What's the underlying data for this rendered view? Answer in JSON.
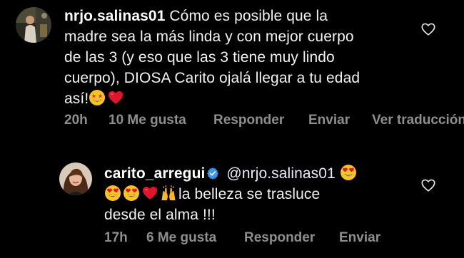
{
  "comments": [
    {
      "username": "nrjo.salinas01",
      "lines": [
        "Cómo es posible que la",
        "madre sea la más linda y con mejor cuerpo",
        "de las 3 (y eso que las 3 tiene muy lindo",
        "cuerpo), DIOSA Carito ojalá llegar a tu edad",
        "así!"
      ],
      "trailing_emojis": [
        "star-struck-emoji",
        "red-heart-emoji"
      ],
      "time": "20h",
      "likes": "10 Me gusta",
      "reply_label": "Responder",
      "send_label": "Enviar",
      "translate_label": "Ver traducción"
    },
    {
      "username": "carito_arregui",
      "verified": true,
      "mention": "@nrjo.salinas01",
      "emoji_sequence": [
        "heart-eyes-emoji",
        "heart-eyes-emoji",
        "heart-eyes-emoji",
        "red-heart-emoji",
        "raising-hands-emoji"
      ],
      "text_line2": "la belleza se trasluce",
      "text_line3": "desde el alma !!!",
      "time": "17h",
      "likes": "6 Me gusta",
      "reply_label": "Responder",
      "send_label": "Enviar"
    }
  ],
  "colors": {
    "background": "#000000",
    "text": "#f2f2f2",
    "meta": "#8e8e8e",
    "verified": "#3897f0",
    "heart": "#e0142b"
  }
}
